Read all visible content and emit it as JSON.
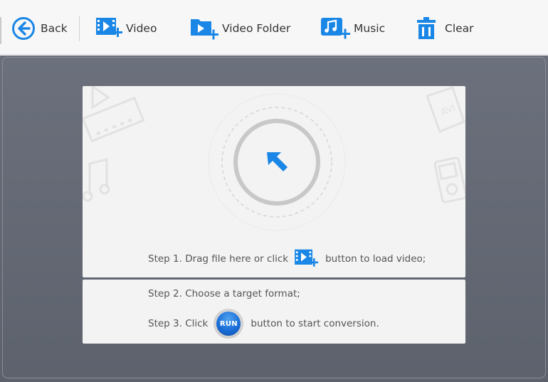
{
  "toolbar": {
    "back_label": "Back",
    "video_label": "Video",
    "video_folder_label": "Video Folder",
    "music_label": "Music",
    "clear_label": "Clear"
  },
  "steps": {
    "step1_before": "Step 1. Drag file here or click",
    "step1_after": "button to load video;",
    "step2": "Step 2. Choose a target format;",
    "step3_before": "Step 3. Click",
    "step3_after": "button to start conversion.",
    "run_label": "RUN"
  },
  "colors": {
    "accent_blue": "#1a86e6",
    "main_bg": "#62676f",
    "panel_bg": "#f3f3f3"
  },
  "icons": [
    "back-arrow-icon",
    "add-video-icon",
    "add-video-folder-icon",
    "add-music-icon",
    "trash-icon",
    "drop-target-arrow-icon"
  ]
}
